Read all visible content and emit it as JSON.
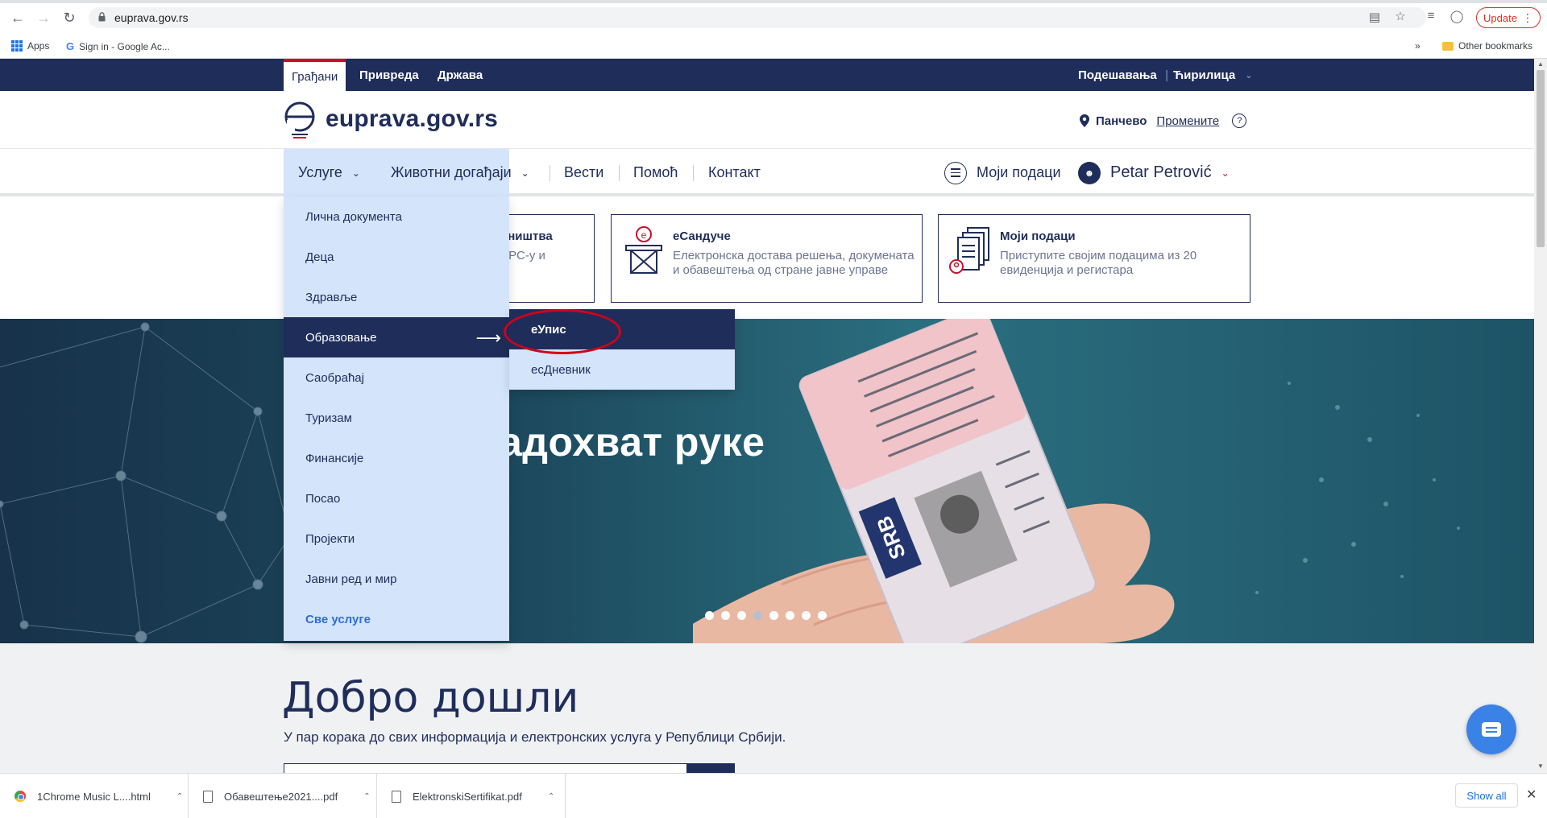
{
  "browser": {
    "url": "euprava.gov.rs",
    "update_label": "Update",
    "bookmarks": [
      "Apps",
      "Sign in - Google Ac..."
    ],
    "other_bookmarks": "Other bookmarks",
    "overflow": "»"
  },
  "site": {
    "top_tabs": [
      "Грађани",
      "Привреда",
      "Држава"
    ],
    "top_right": [
      "Подешавања",
      "Ћирилица"
    ],
    "logo_text": "euprava.gov.rs",
    "location_name": "Панчево",
    "location_change": "Промените",
    "help_glyph": "?",
    "nav": {
      "services": "Услуге",
      "life_events": "Животни догађаји",
      "news": "Вести",
      "help": "Помоћ",
      "contact": "Контакт",
      "my_data": "Моји подаци",
      "user_name": "Petar Petrović"
    },
    "cards": [
      {
        "title": "вништва",
        "desc": "ДРС-у и"
      },
      {
        "title": "еСандуче",
        "desc": "Електронска достава решења, докумената и обавештења од стране јавне управе"
      },
      {
        "title": "Моји подаци",
        "desc": "Приступите својим подацима из 20 евиденција и регистара"
      }
    ],
    "hero_headline": "адохват руке",
    "hero_dots": 8,
    "hero_active_dot": 4,
    "welcome_title": "Добро дошли",
    "welcome_subtitle": "У пар корака до свих информација и електронских услуга у Републици Србији."
  },
  "services_menu": {
    "items": [
      "Лична документа",
      "Деца",
      "Здравље",
      "Образовање",
      "Саобраћај",
      "Туризам",
      "Финансије",
      "Посао",
      "Пројекти",
      "Јавни ред и мир"
    ],
    "active": "Образовање",
    "all_services": "Све услуге",
    "submenu": [
      "еУпис",
      "есДневник"
    ],
    "submenu_active": "еУпис"
  },
  "downloads": {
    "items": [
      "1Chrome Music L....html",
      "Обавештење2021....pdf",
      "ElektronskiSertifikat.pdf"
    ],
    "show_all": "Show all"
  },
  "colors": {
    "navy": "#1f2d5a",
    "menu_bg": "#d4e4fb",
    "accent_red": "#c8102e",
    "chat_blue": "#3b82e6"
  }
}
